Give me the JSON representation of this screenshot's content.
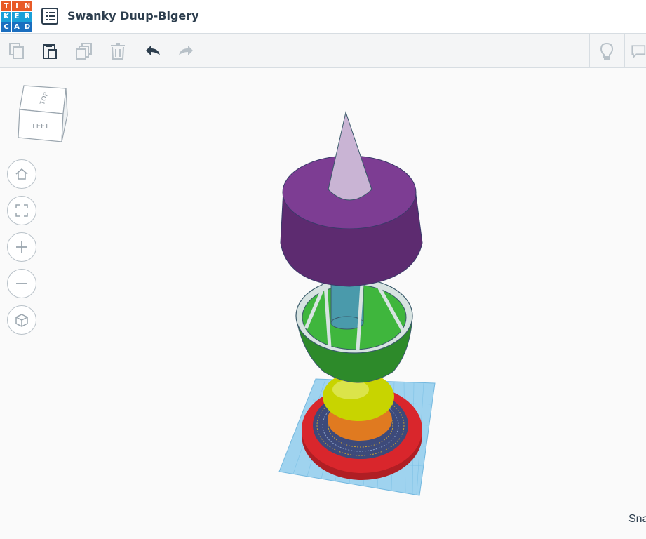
{
  "logo": {
    "letters": [
      "T",
      "I",
      "N",
      "K",
      "E",
      "R",
      "C",
      "A",
      "D"
    ],
    "colors": [
      "#e85a27",
      "#e85a27",
      "#e85a27",
      "#1aa0d8",
      "#1aa0d8",
      "#1aa0d8",
      "#1a6ebf",
      "#1a6ebf",
      "#1a6ebf"
    ]
  },
  "header": {
    "title": "Swanky Duup-Bigery"
  },
  "viewcube": {
    "top_label": "TOP",
    "left_label": "LEFT"
  },
  "status": {
    "snap_text": "Sna"
  },
  "colors": {
    "icon_active": "#2d3e4e",
    "icon_disabled": "#b8c1c8",
    "workplane": "#9fd3ef",
    "cone": "#c9b4d4",
    "cylinder_top": "#7d3d93",
    "cylinder_side": "#5d2b70",
    "green": "#2d8a2a",
    "yellow": "#c8d400",
    "orange": "#e07a20",
    "red": "#d9262c"
  }
}
